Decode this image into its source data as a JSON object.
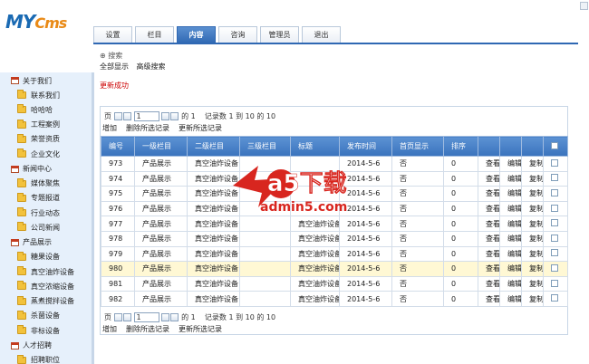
{
  "logo": {
    "my": "MY",
    "cms": "Cms"
  },
  "nav": {
    "tabs": [
      "设置",
      "栏目",
      "内容",
      "咨询",
      "管理员",
      "退出"
    ],
    "active_index": 2
  },
  "sidebar": {
    "groups": [
      {
        "label": "关于我们",
        "items": [
          "联系我们",
          "哈哈哈",
          "工程案例",
          "荣誉资质",
          "企业文化"
        ]
      },
      {
        "label": "新闻中心",
        "items": [
          "媒体聚焦",
          "专题报道",
          "行业动态",
          "公司新闻"
        ]
      },
      {
        "label": "产品展示",
        "items": [
          "糖果设备",
          "真空油炸设备",
          "真空浓缩设备",
          "蒸煮搅拌设备",
          "杀菌设备",
          "非标设备"
        ]
      },
      {
        "label": "人才招聘",
        "items": [
          "招聘职位"
        ]
      }
    ]
  },
  "search": {
    "label": "⊕ 搜索",
    "all": "全部显示",
    "advanced": "高级搜索"
  },
  "message": "更新成功",
  "pager": {
    "page_label": "页",
    "page_value": "1",
    "of_label": "的",
    "total_pages": "1",
    "records_text": "记录数 1 到 10 的 10"
  },
  "actions": {
    "add": "增加",
    "delete": "删除所选记录",
    "update": "更新所选记录"
  },
  "table": {
    "columns": [
      "编号",
      "一级栏目",
      "二级栏目",
      "三级栏目",
      "标题",
      "发布时间",
      "首页显示",
      "排序",
      "",
      "",
      "",
      ""
    ],
    "rows": [
      {
        "id": "973",
        "c1": "产品展示",
        "c2": "真空油炸设备",
        "c3": "",
        "title": "",
        "date": "2014-5-6",
        "home": "否",
        "sort": "0"
      },
      {
        "id": "974",
        "c1": "产品展示",
        "c2": "真空油炸设备",
        "c3": "",
        "title": "",
        "date": "2014-5-6",
        "home": "否",
        "sort": "0"
      },
      {
        "id": "975",
        "c1": "产品展示",
        "c2": "真空油炸设备",
        "c3": "",
        "title": "",
        "date": "2014-5-6",
        "home": "否",
        "sort": "0"
      },
      {
        "id": "976",
        "c1": "产品展示",
        "c2": "真空油炸设备",
        "c3": "",
        "title": "",
        "date": "2014-5-6",
        "home": "否",
        "sort": "0"
      },
      {
        "id": "977",
        "c1": "产品展示",
        "c2": "真空油炸设备",
        "c3": "",
        "title": "真空油炸设备",
        "date": "2014-5-6",
        "home": "否",
        "sort": "0"
      },
      {
        "id": "978",
        "c1": "产品展示",
        "c2": "真空油炸设备",
        "c3": "",
        "title": "真空油炸设备",
        "date": "2014-5-6",
        "home": "否",
        "sort": "0"
      },
      {
        "id": "979",
        "c1": "产品展示",
        "c2": "真空油炸设备",
        "c3": "",
        "title": "真空油炸设备",
        "date": "2014-5-6",
        "home": "否",
        "sort": "0"
      },
      {
        "id": "980",
        "c1": "产品展示",
        "c2": "真空油炸设备",
        "c3": "",
        "title": "真空油炸设备",
        "date": "2014-5-6",
        "home": "否",
        "sort": "0"
      },
      {
        "id": "981",
        "c1": "产品展示",
        "c2": "真空油炸设备",
        "c3": "",
        "title": "真空油炸设备",
        "date": "2014-5-6",
        "home": "否",
        "sort": "0"
      },
      {
        "id": "982",
        "c1": "产品展示",
        "c2": "真空油炸设备",
        "c3": "",
        "title": "真空油炸设备",
        "date": "2014-5-6",
        "home": "否",
        "sort": "0"
      }
    ],
    "highlight_row": 7,
    "ops": {
      "view": "查看",
      "edit": "编辑",
      "copy": "复制"
    }
  },
  "watermark": {
    "big": "a5下载",
    "url": "admin5.com"
  },
  "colors": {
    "accent": "#2f68b3",
    "highlight_row": "#fff8d4",
    "success": "#cc0000",
    "logo_orange": "#e98a16"
  }
}
